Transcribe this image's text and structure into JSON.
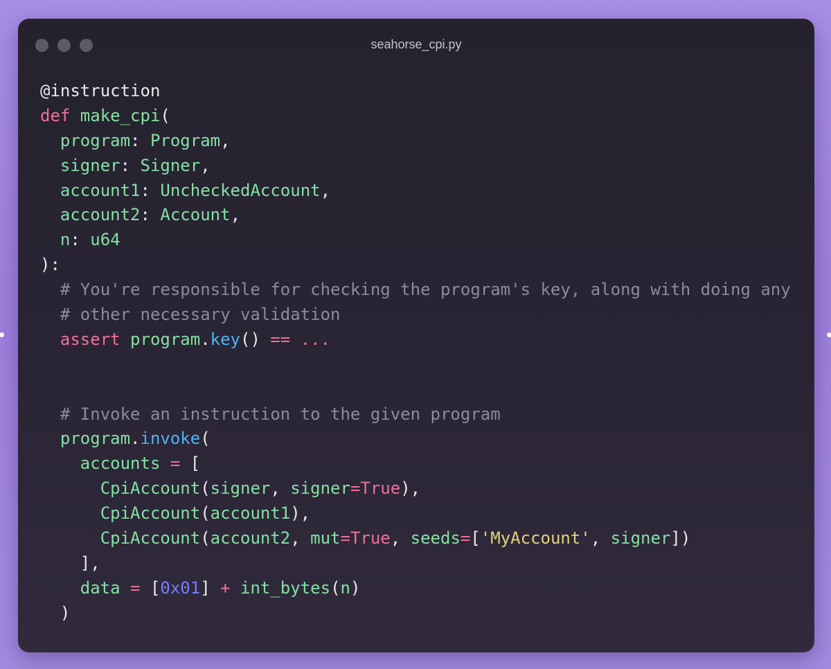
{
  "colors": {
    "background": "#a78de6",
    "window": "#2a2535",
    "traffic_light": "#5d5b63",
    "identifier": "#85e0a3",
    "keyword": "#f0709a",
    "punctuation": "#eaeaea",
    "comment": "#8e8a9c",
    "function": "#4cb4f5",
    "number": "#7b7bff",
    "string": "#e3d27c"
  },
  "window": {
    "filename": "seahorse_cpi.py",
    "traffic_lights": [
      "close",
      "minimize",
      "zoom"
    ]
  },
  "code": {
    "lines": [
      [
        [
          "deco",
          "@instruction"
        ]
      ],
      [
        [
          "kw",
          "def"
        ],
        [
          "plain",
          " make_cpi"
        ],
        [
          "p",
          "("
        ]
      ],
      [
        [
          "plain",
          "  program"
        ],
        [
          "p",
          ": "
        ],
        [
          "plain",
          "Program"
        ],
        [
          "p",
          ","
        ]
      ],
      [
        [
          "plain",
          "  signer"
        ],
        [
          "p",
          ": "
        ],
        [
          "plain",
          "Signer"
        ],
        [
          "p",
          ","
        ]
      ],
      [
        [
          "plain",
          "  account1"
        ],
        [
          "p",
          ": "
        ],
        [
          "plain",
          "UncheckedAccount"
        ],
        [
          "p",
          ","
        ]
      ],
      [
        [
          "plain",
          "  account2"
        ],
        [
          "p",
          ": "
        ],
        [
          "plain",
          "Account"
        ],
        [
          "p",
          ","
        ]
      ],
      [
        [
          "plain",
          "  n"
        ],
        [
          "p",
          ": "
        ],
        [
          "plain",
          "u64"
        ]
      ],
      [
        [
          "p",
          "):"
        ]
      ],
      [
        [
          "cmt",
          "  # You're responsible for checking the program's key, along with doing any"
        ]
      ],
      [
        [
          "cmt",
          "  # other necessary validation"
        ]
      ],
      [
        [
          "kw",
          "  assert"
        ],
        [
          "plain",
          " program"
        ],
        [
          "p",
          "."
        ],
        [
          "fn",
          "key"
        ],
        [
          "p",
          "() "
        ],
        [
          "kw",
          "=="
        ],
        [
          "kw",
          " ..."
        ]
      ],
      [],
      [],
      [
        [
          "cmt",
          "  # Invoke an instruction to the given program"
        ]
      ],
      [
        [
          "plain",
          "  program"
        ],
        [
          "p",
          "."
        ],
        [
          "fn",
          "invoke"
        ],
        [
          "p",
          "("
        ]
      ],
      [
        [
          "plain",
          "    accounts"
        ],
        [
          "kw",
          " ="
        ],
        [
          "p",
          " ["
        ]
      ],
      [
        [
          "plain",
          "      CpiAccount"
        ],
        [
          "p",
          "("
        ],
        [
          "plain",
          "signer"
        ],
        [
          "p",
          ", "
        ],
        [
          "plain",
          "signer"
        ],
        [
          "kw",
          "="
        ],
        [
          "kw",
          "True"
        ],
        [
          "p",
          "),"
        ]
      ],
      [
        [
          "plain",
          "      CpiAccount"
        ],
        [
          "p",
          "("
        ],
        [
          "plain",
          "account1"
        ],
        [
          "p",
          "),"
        ]
      ],
      [
        [
          "plain",
          "      CpiAccount"
        ],
        [
          "p",
          "("
        ],
        [
          "plain",
          "account2"
        ],
        [
          "p",
          ", "
        ],
        [
          "plain",
          "mut"
        ],
        [
          "kw",
          "="
        ],
        [
          "kw",
          "True"
        ],
        [
          "p",
          ", "
        ],
        [
          "plain",
          "seeds"
        ],
        [
          "kw",
          "="
        ],
        [
          "p",
          "["
        ],
        [
          "str",
          "'MyAccount'"
        ],
        [
          "p",
          ", "
        ],
        [
          "plain",
          "signer"
        ],
        [
          "p",
          "])"
        ]
      ],
      [
        [
          "p",
          "    ],"
        ]
      ],
      [
        [
          "plain",
          "    data"
        ],
        [
          "kw",
          " ="
        ],
        [
          "p",
          " ["
        ],
        [
          "num",
          "0x01"
        ],
        [
          "p",
          "] "
        ],
        [
          "kw",
          "+"
        ],
        [
          "plain",
          " int_bytes"
        ],
        [
          "p",
          "("
        ],
        [
          "plain",
          "n"
        ],
        [
          "p",
          ")"
        ]
      ],
      [
        [
          "p",
          "  )"
        ]
      ]
    ]
  }
}
